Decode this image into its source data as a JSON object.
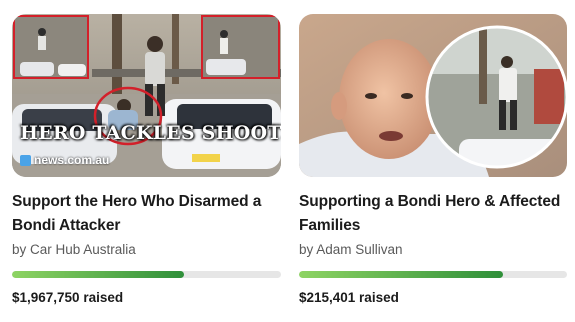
{
  "cards": [
    {
      "title": "Support the Hero Who Disarmed a Bondi Attacker",
      "organizer": "by Car Hub Australia",
      "progress_fraction": 0.64,
      "raised": "$1,967,750 raised",
      "image": {
        "overlay_text": "HERO TACKLES SHOOTER",
        "logo_text": "news.com.au"
      }
    },
    {
      "title": "Supporting a Bondi Hero & Affected Families",
      "organizer": "by Adam Sullivan",
      "progress_fraction": 0.76,
      "raised": "$215,401 raised"
    }
  ],
  "colors": {
    "progress_start": "#8ed463",
    "progress_end": "#2f8f3a",
    "progress_track": "#e6e6e6",
    "frame_red": "#d3202a"
  }
}
